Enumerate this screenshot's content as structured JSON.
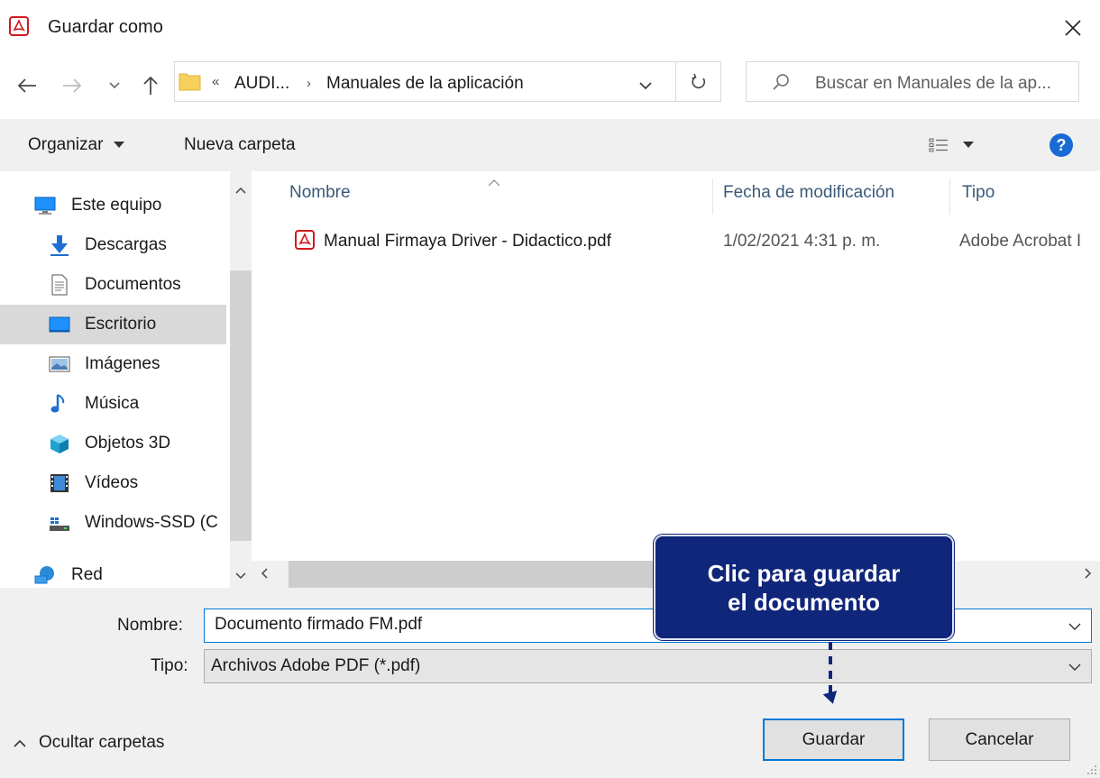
{
  "window": {
    "title": "Guardar como"
  },
  "address": {
    "overflow": "«",
    "segments": [
      "AUDI...",
      "Manuales de la aplicación"
    ],
    "separator": "›"
  },
  "search": {
    "placeholder": "Buscar en Manuales de la ap..."
  },
  "toolbar": {
    "organize": "Organizar",
    "new_folder": "Nueva carpeta",
    "help": "?"
  },
  "nav": {
    "items": [
      {
        "label": "Este equipo",
        "icon": "computer-icon"
      },
      {
        "label": "Descargas",
        "icon": "download-icon"
      },
      {
        "label": "Documentos",
        "icon": "document-icon"
      },
      {
        "label": "Escritorio",
        "icon": "desktop-icon",
        "selected": true
      },
      {
        "label": "Imágenes",
        "icon": "pictures-icon"
      },
      {
        "label": "Música",
        "icon": "music-icon"
      },
      {
        "label": "Objetos 3D",
        "icon": "cube-icon"
      },
      {
        "label": "Vídeos",
        "icon": "video-icon"
      },
      {
        "label": "Windows-SSD (C",
        "icon": "drive-icon"
      },
      {
        "label": "Red",
        "icon": "network-icon"
      }
    ]
  },
  "filelist": {
    "columns": [
      "Nombre",
      "Fecha de modificación",
      "Tipo"
    ],
    "rows": [
      {
        "name": "Manual Firmaya Driver - Didactico.pdf",
        "date": "1/02/2021 4:31 p. m.",
        "type": "Adobe Acrobat I"
      }
    ]
  },
  "form": {
    "name_label": "Nombre:",
    "name_value": "Documento firmado FM.pdf",
    "type_label": "Tipo:",
    "type_value": "Archivos Adobe PDF (*.pdf)"
  },
  "footer": {
    "hide_folders": "Ocultar carpetas",
    "save": "Guardar",
    "cancel": "Cancelar"
  },
  "callout": {
    "line1": "Clic para guardar",
    "line2": "el documento"
  },
  "colors": {
    "accent": "#0078d7",
    "callout_bg": "#10267a",
    "pdf_red": "#d0181d",
    "selected_bg": "#d9d9d9",
    "bar_bg": "#f0f0f0"
  }
}
